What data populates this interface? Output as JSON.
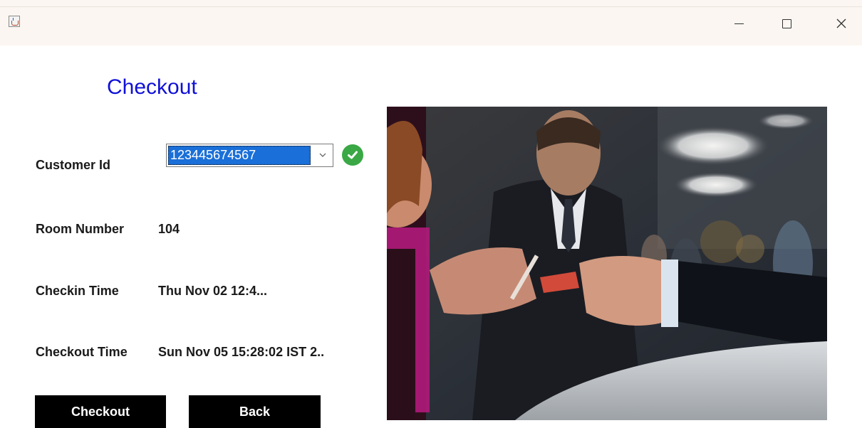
{
  "window": {
    "app_icon": "java-cup-icon",
    "minimize_icon": "minimize-icon",
    "maximize_icon": "maximize-icon",
    "close_icon": "close-icon"
  },
  "form": {
    "title": "Checkout",
    "customer_id": {
      "label": "Customer Id",
      "selected_value": "123445674567",
      "status_icon": "check-circle-icon"
    },
    "room_number": {
      "label": "Room Number",
      "value": "104"
    },
    "checkin_time": {
      "label": "Checkin Time",
      "value": "Thu Nov 02 12:4..."
    },
    "checkout_time": {
      "label": "Checkout Time",
      "value": "Sun Nov 05 15:28:02 IST 2.."
    }
  },
  "buttons": {
    "checkout": "Checkout",
    "back": "Back"
  },
  "colors": {
    "title": "#1010d8",
    "selection": "#1a6fd8",
    "button_bg": "#000000",
    "check": "#3aa845"
  }
}
